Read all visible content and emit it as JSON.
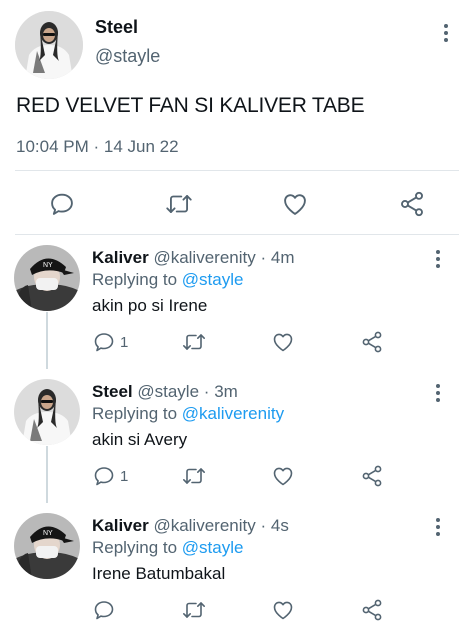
{
  "main_tweet": {
    "display_name": "Steel",
    "handle": "@stayle",
    "text": "RED VELVET FAN SI KALIVER TABE",
    "timestamp": "10:04 PM · 14 Jun 22",
    "actions": [
      "reply-icon",
      "retweet-icon",
      "like-icon",
      "share-icon"
    ]
  },
  "replies": [
    {
      "display_name": "Kaliver",
      "handle": "@kaliverenity",
      "separator": "·",
      "time_ago": "4m",
      "replying_prefix": "Replying to",
      "replying_to": "@stayle",
      "text": "akin po si Irene",
      "reply_count": "1"
    },
    {
      "display_name": "Steel",
      "handle": "@stayle",
      "separator": "·",
      "time_ago": "3m",
      "replying_prefix": "Replying to",
      "replying_to": "@kaliverenity",
      "text": "akin si Avery",
      "reply_count": "1"
    },
    {
      "display_name": "Kaliver",
      "handle": "@kaliverenity",
      "separator": "·",
      "time_ago": "4s",
      "replying_prefix": "Replying to",
      "replying_to": "@stayle",
      "text": "Irene Batumbakal",
      "reply_count": ""
    }
  ],
  "colors": {
    "text": "#0f1419",
    "secondary": "#536471",
    "link": "#1d9bf0",
    "icon": "#536471",
    "thread_line": "#cfd9de"
  }
}
